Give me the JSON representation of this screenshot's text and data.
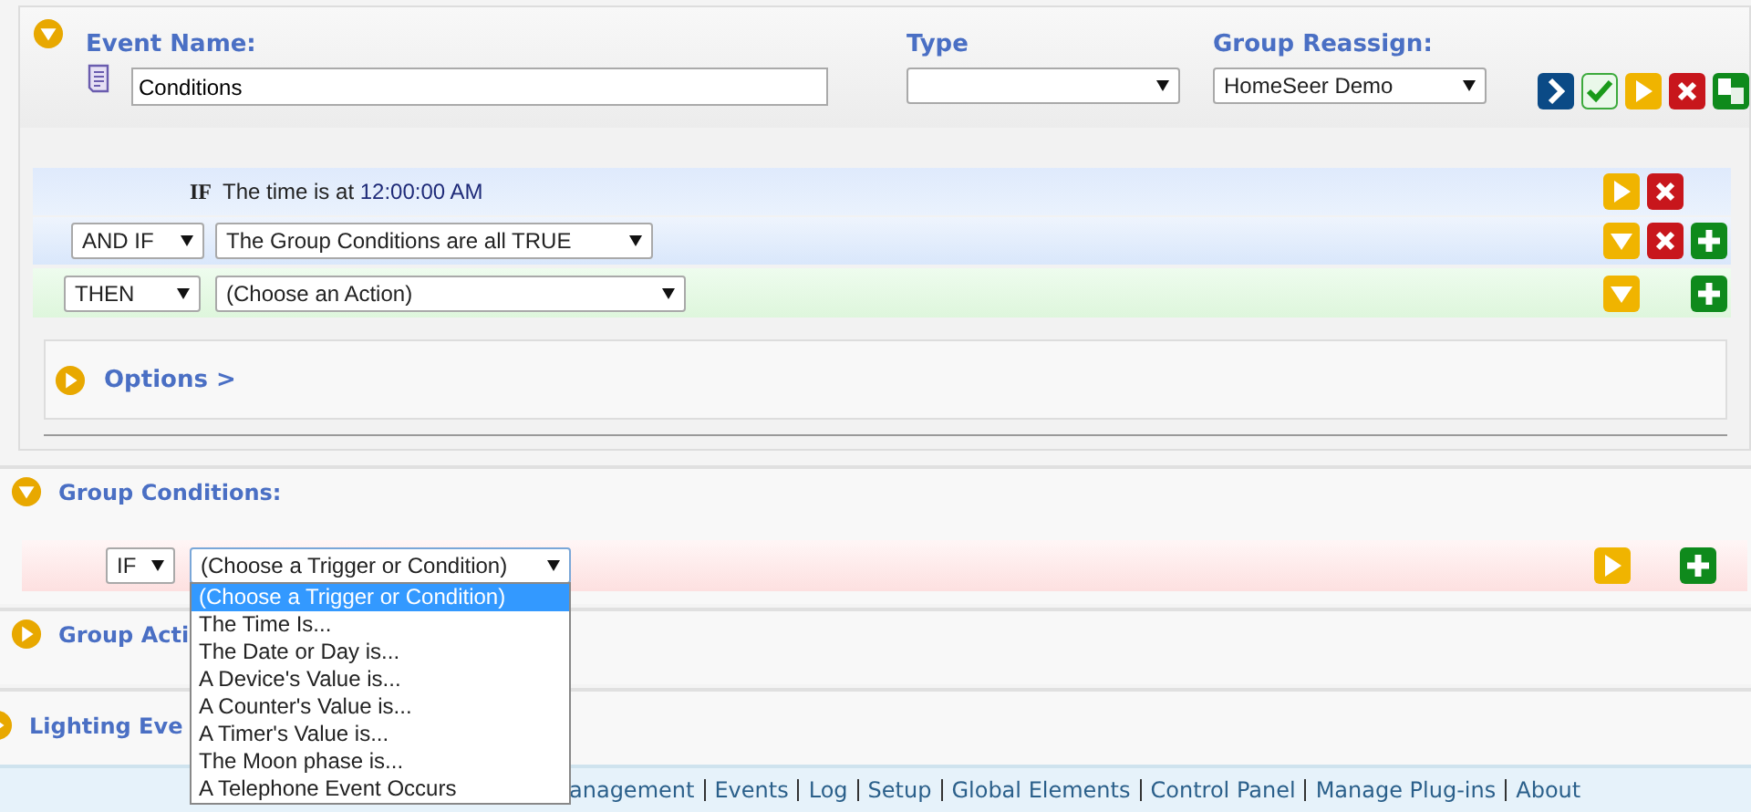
{
  "event": {
    "expanded": true,
    "name_label": "Event Name:",
    "name_value": "Conditions",
    "type_label": "Type",
    "group_label": "Group Reassign:",
    "group_value": "HomeSeer Demo",
    "actions": [
      {
        "kind": "next"
      },
      {
        "kind": "save"
      },
      {
        "kind": "run"
      },
      {
        "kind": "delete"
      },
      {
        "kind": "copy"
      }
    ]
  },
  "rules": [
    {
      "kind": "trigger",
      "keyword": "IF",
      "text": "The time is at",
      "time": "12:00:00 AM",
      "actions": [
        {
          "kind": "run"
        },
        {
          "kind": "delete"
        }
      ]
    },
    {
      "kind": "condition",
      "keyword": "AND IF",
      "value": "The Group Conditions are all TRUE",
      "actions": [
        {
          "kind": "collapse"
        },
        {
          "kind": "delete"
        },
        {
          "kind": "add"
        }
      ]
    },
    {
      "kind": "action",
      "keyword": "THEN",
      "value": "(Choose an Action)",
      "actions": [
        {
          "kind": "collapse"
        },
        {
          "kind": "add"
        }
      ]
    }
  ],
  "options": {
    "label": "Options >",
    "expanded": false
  },
  "group_conditions": {
    "title": "Group Conditions:",
    "expanded": true,
    "keyword": "IF",
    "value": "(Choose a Trigger or Condition)",
    "open": true,
    "choices": [
      {
        "label": "(Choose a Trigger or Condition)",
        "selected": true
      },
      {
        "label": "The Time Is...",
        "selected": false
      },
      {
        "label": "The Date or Day is...",
        "selected": false
      },
      {
        "label": "A Device's Value is...",
        "selected": false
      },
      {
        "label": "A Counter's Value is...",
        "selected": false
      },
      {
        "label": "A Timer's Value is...",
        "selected": false
      },
      {
        "label": "The Moon phase is...",
        "selected": false
      },
      {
        "label": "A Telephone Event Occurs",
        "selected": false
      }
    ],
    "actions": [
      {
        "kind": "run"
      },
      {
        "kind": "add"
      }
    ]
  },
  "group_actions": {
    "title": "Group Acti",
    "expanded": false
  },
  "lighting_events": {
    "title": "Lighting Eve",
    "expanded": false
  },
  "footer_links": [
    "anagement",
    "Events",
    "Log",
    "Setup",
    "Global Elements",
    "Control Panel",
    "Manage Plug-ins",
    "About"
  ]
}
